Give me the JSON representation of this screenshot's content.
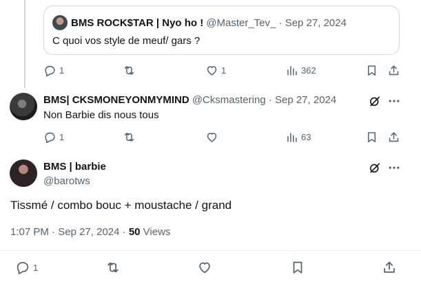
{
  "quoted_tweet": {
    "author_name": "BMS ROCK$TAR | Nyo ho !",
    "author_handle": "@Master_Tev_",
    "separator": " · ",
    "date": "Sep 27, 2024",
    "text": "C quoi vos style de meuf/ gars ?"
  },
  "first_actions": {
    "reply_count": "1",
    "like_count": "1",
    "views_count": "362"
  },
  "reply_tweet": {
    "author_name": "BMS| CKSMONEYONMYMIND",
    "author_handle": "@Cksmastering",
    "separator": " · ",
    "date": "Sep 27, 2024",
    "text": "Non Barbie dis nous tous",
    "reply_count": "1",
    "views_count": "63"
  },
  "main_tweet": {
    "author_name": "BMS | barbie",
    "author_handle": "@barotws",
    "text": "Tissmé / combo bouc + moustache / grand",
    "time": "1:07 PM",
    "separator": " · ",
    "date": "Sep 27, 2024",
    "separator2": " · ",
    "views_number": "50",
    "views_label": " Views",
    "reply_count": "1"
  },
  "colors": {
    "text": "#0f1419",
    "muted": "#536471",
    "border": "#cfd9de"
  },
  "icons": [
    "reply-icon",
    "retweet-icon",
    "like-icon",
    "views-icon",
    "bookmark-icon",
    "share-icon",
    "grok-icon",
    "more-icon"
  ]
}
